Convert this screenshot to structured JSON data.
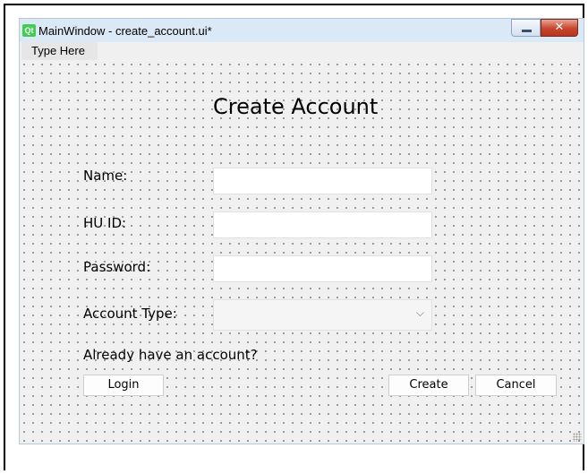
{
  "window": {
    "title": "MainWindow - create_account.ui*",
    "logo_text": "Qt",
    "close_glyph": "✕"
  },
  "menubar": {
    "items": [
      {
        "label": "Type Here"
      }
    ]
  },
  "form": {
    "heading": "Create Account",
    "name_label": "Name:",
    "name_value": "",
    "hu_id_label": "HU ID:",
    "hu_id_value": "",
    "password_label": "Password:",
    "password_value": "",
    "account_type_label": "Account Type:",
    "account_type_value": "",
    "already_text": "Already have an account?",
    "login_button": "Login",
    "create_button": "Create",
    "cancel_button": "Cancel"
  },
  "icons": {
    "combo_arrow": "chevron-down-icon",
    "logo": "qt-logo-icon",
    "minimize": "minimize-icon",
    "close": "close-icon"
  },
  "colors": {
    "qt_green": "#41cd52",
    "close_red": "#c6452c",
    "titlebar": "#dbe8f6",
    "canvas": "#f0f0f0"
  }
}
